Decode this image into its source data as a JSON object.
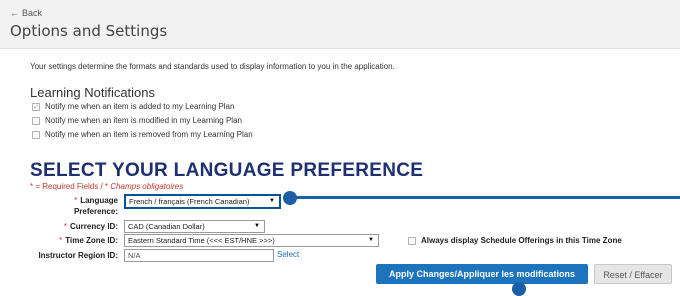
{
  "nav": {
    "back_label": "Back",
    "back_icon": "arrow-left"
  },
  "page": {
    "title": "Options and Settings",
    "intro": "Your settings determine the formats and standards used to display information to you in the application."
  },
  "learning_notifications": {
    "heading": "Learning Notifications",
    "items": [
      {
        "label": "Notify me when an item is added to my Learning Plan",
        "checked": true
      },
      {
        "label": "Notify me when an item is modified in my Learning Plan",
        "checked": false
      },
      {
        "label": "Notify me when an item is removed from my Learning Plan",
        "checked": false
      }
    ]
  },
  "language_section": {
    "heading": "SELECT YOUR LANGUAGE PREFERENCE",
    "required_note_prefix": "* = Required Fields / *",
    "required_note_fr": "Champs obligatoires"
  },
  "form": {
    "language": {
      "label_line1": "Language",
      "label_line2": "Preference:",
      "value": "French / français (French Canadian)"
    },
    "currency": {
      "label": "Currency ID:",
      "value": "CAD (Canadian Dollar)"
    },
    "timezone": {
      "label": "Time Zone ID:",
      "value": "Eastern Standard Time (<<< EST/HNE >>>)"
    },
    "always_display": {
      "label": "Always display Schedule Offerings in this Time Zone",
      "checked": false
    },
    "instructor_region": {
      "label": "Instructor Region ID:",
      "value": "N/A",
      "select_link": "Select"
    }
  },
  "buttons": {
    "apply": "Apply Changes/Appliquer les modifications",
    "reset": "Reset / Effacer"
  },
  "colors": {
    "accent": "#1c75bc",
    "heading": "#1f2f73",
    "required": "#c0392b",
    "annotation": "#1c5fa7"
  }
}
